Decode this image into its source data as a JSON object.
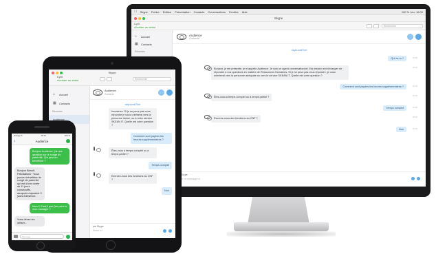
{
  "mac": {
    "menubar": [
      "Skype",
      "Fichier",
      "Édition",
      "Présentation",
      "Contacts",
      "Conversations",
      "Fenêtre",
      "Aide"
    ],
    "status": "100 %  Jeu. 16:00",
    "window_title": "Skype",
    "user": {
      "name": "Cyril",
      "status": "Accéder au statut"
    },
    "search_placeholder": "Rechercher",
    "sidebar": [
      {
        "label": "Accueil",
        "icon": "home-icon"
      },
      {
        "label": "Contacts",
        "icon": "contacts-icon"
      }
    ],
    "sidebar_section": "Récentes",
    "chat": {
      "name": "Audience",
      "sub": "Connecté",
      "system": "skyburn67bel",
      "messages": [
        {
          "dir": "out",
          "text": "Qui es-tu ?",
          "time": "16:00"
        },
        {
          "dir": "in",
          "text": "Bonjour, je me présente, je m'appelle Audience. Je suis un agent conversationnel. Ma mission est d'essayer de répondre à vos questions en matière de Ressources Humaines. Si je ne peux pas vous répondre, je vous orienterai vers la personne adéquate ou vers le service SKEAN IT. Quelle est votre question ?",
          "time": "16:00"
        },
        {
          "dir": "out",
          "text": "Comment sont payées les heures supplémentaires ?",
          "time": "16:00"
        },
        {
          "dir": "in",
          "text": "Êtes-vous à temps complet ou à temps partiel ?",
          "time": "16:00"
        },
        {
          "dir": "out",
          "text": "Temps complet",
          "time": "16:00"
        },
        {
          "dir": "in",
          "text": "Exercez-vous des fonctions au CNF ?",
          "time": "16:00"
        },
        {
          "dir": "out",
          "text": "Non",
          "time": "16:00"
        }
      ],
      "compose_label": "par Skype",
      "compose_placeholder": "Entrer un message ici"
    }
  },
  "ipad": {
    "window_title": "Skype",
    "user": {
      "name": "Cyril",
      "status": "Accéder au statut"
    },
    "search_placeholder": "Rechercher",
    "sidebar": [
      {
        "label": "Accueil",
        "icon": "home-icon"
      },
      {
        "label": "Contacts",
        "icon": "contacts-icon"
      }
    ],
    "sidebar_section": "Récentes",
    "sidebar_highlight": "Audience",
    "chat": {
      "name": "Audience",
      "sub": "Connecté",
      "system": "skyburn67bel",
      "msg_in_1": "humaines. Si je ne peux pas vous répondre je vous orienterai vers la personne idoine, ou à votre service SKEAN IT. Quelle est votre question ?",
      "msg_out_1": "Comment sont payées les heures supplémentaires ?",
      "msg_in_2": "Êtes-vous à temps complet ou à temps partiel ?",
      "msg_out_2": "Temps complet",
      "msg_in_3": "Exercez-vous des fonctions au CNF ?",
      "msg_out_3": "Non",
      "compose_label": "par Skype",
      "compose_placeholder": "Entrer ici"
    }
  },
  "iphone": {
    "status_left": "Orange F",
    "status_center": "16:10",
    "status_right": "100 %",
    "title": "Audience",
    "messages": [
      {
        "dir": "out",
        "text": "Bonjour Audience, j'ai une question sur le congé de paternité. Qui peut en bénéficier ?"
      },
      {
        "dir": "in",
        "text": "Bonjour Benoît. Félicitations ! Vous pouvez bénéficier du congé de paternité qui est d'une durée de 11 jours consécutifs, auxquels s'ajoutent 3 jours d'absence."
      },
      {
        "dir": "out",
        "text": "Merci ! Faut-il que j'en parle à mon manager ?"
      },
      {
        "dir": "in",
        "text": "Vous devez les utiliser..."
      }
    ],
    "compose_placeholder": "Message"
  },
  "colors": {
    "accent": "#5aa7e8",
    "green": "#3bbf4a",
    "out_bubble": "#d9ecfb"
  }
}
